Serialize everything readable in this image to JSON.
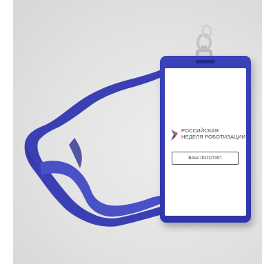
{
  "scene": {
    "description_kind": "photo-mockup",
    "colors": {
      "lanyard": "#3a40b4",
      "card_frame": "#3a42b8",
      "clip": "#c9c9c9",
      "brand_red": "#e23a36",
      "brand_blue": "#2f4fb4",
      "brand_gray": "#7b7b7b"
    }
  },
  "badge": {
    "brand_line1": "РОССИЙСКАЯ",
    "brand_line2": "НЕДЕЛЯ РОБОТИЗАЦИИ",
    "logo_placeholder": "ВАШ ЛОГОТИП"
  },
  "icons": {
    "brand_mark": "star-logo-icon",
    "clip": "lanyard-clip-icon"
  }
}
